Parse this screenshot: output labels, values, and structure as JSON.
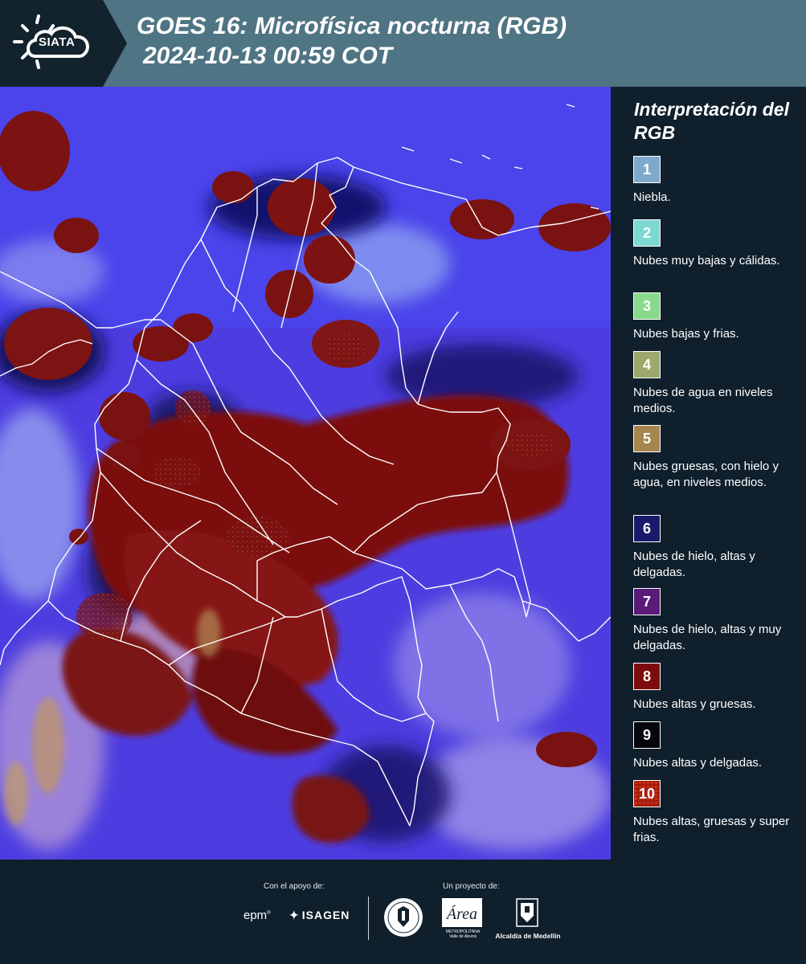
{
  "header": {
    "logo_text": "SIATA",
    "title_line_1": "GOES 16: Microfísica nocturna (RGB)",
    "title_line_2": "2024-10-13 00:59 COT",
    "background_color": "#4f7483",
    "logo_block_color": "#13232e"
  },
  "legend": {
    "title": "Interpretación del RGB",
    "items": [
      {
        "number": "1",
        "color": "#7fa9cc",
        "description": "Niebla."
      },
      {
        "number": "2",
        "color": "#7ed8d2",
        "description": "Nubes muy bajas y cálidas."
      },
      {
        "number": "3",
        "color": "#88d98b",
        "description": "Nubes bajas y frias."
      },
      {
        "number": "4",
        "color": "#9ca96a",
        "description": "Nubes de agua en niveles medios."
      },
      {
        "number": "5",
        "color": "#a5864f",
        "description": "Nubes gruesas, con hielo y agua, en niveles medios."
      },
      {
        "number": "6",
        "color": "#1a1a6a",
        "description": "Nubes de hielo, altas y delgadas."
      },
      {
        "number": "7",
        "color": "#5a1a7a",
        "description": "Nubes de hielo, altas y muy delgadas."
      },
      {
        "number": "8",
        "color": "#7d0c0c",
        "description": "Nubes altas y gruesas."
      },
      {
        "number": "9",
        "color": "#05050a",
        "description": "Nubes altas y delgadas."
      },
      {
        "number": "10",
        "color": "#a81a0a",
        "description": "Nubes altas, gruesas y super frias."
      }
    ]
  },
  "footer": {
    "support_caption": "Con el apoyo de:",
    "project_caption": "Un proyecto de:",
    "epm_logo": "epm",
    "isagen_logo": "ISAGEN",
    "area_logo_text": "METROPOLITANA Valle de Aburrá",
    "alcaldia_logo_text": "Alcaldía de Medellín"
  },
  "map": {
    "image_description_colors": {
      "background": "#4a3ad8",
      "thick_cloud": "#7a1010",
      "thin_ice": "#1e1a7a"
    }
  }
}
